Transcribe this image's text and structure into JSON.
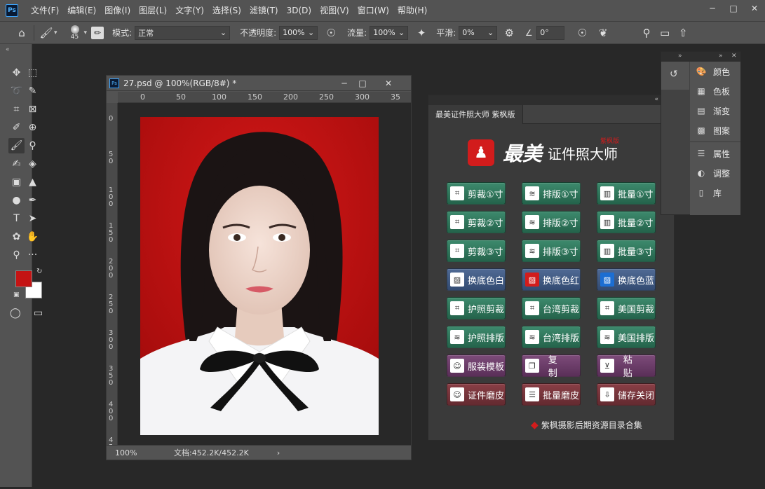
{
  "app": {
    "logo": "Ps",
    "menu": [
      "文件(F)",
      "编辑(E)",
      "图像(I)",
      "图层(L)",
      "文字(Y)",
      "选择(S)",
      "滤镜(T)",
      "3D(D)",
      "视图(V)",
      "窗口(W)",
      "帮助(H)"
    ],
    "window_controls": [
      "minimize-icon",
      "maximize-icon",
      "close-icon"
    ]
  },
  "options": {
    "brush_size": "45",
    "mode_label": "模式:",
    "mode_value": "正常",
    "opacity_label": "不透明度:",
    "opacity_value": "100%",
    "flow_label": "流量:",
    "flow_value": "100%",
    "smooth_label": "平滑:",
    "smooth_value": "0%",
    "angle_value": "0°"
  },
  "toolbar": {
    "tools": [
      "move-icon",
      "marquee-icon",
      "lasso-icon",
      "quick-select-icon",
      "crop-icon",
      "frame-icon",
      "eyedropper-icon",
      "spot-heal-icon",
      "brush-icon",
      "stamp-icon",
      "history-brush-icon",
      "eraser-icon",
      "gradient-icon",
      "blur-icon",
      "dodge-icon",
      "pen-icon",
      "type-icon",
      "path-select-icon",
      "shape-icon",
      "hand-icon",
      "zoom-icon",
      "more-icon"
    ],
    "colors": {
      "foreground": "#c41414",
      "background": "#ffffff"
    }
  },
  "document": {
    "title": "27.psd @ 100%(RGB/8#) *",
    "ruler_h": [
      "0",
      "50",
      "100",
      "150",
      "200",
      "250",
      "300",
      "35"
    ],
    "ruler_v": [
      "0",
      "5 0",
      "1 0 0",
      "1 5 0",
      "2 0 0",
      "2 5 0",
      "3 0 0",
      "3 5 0",
      "4 0 0",
      "4 5"
    ],
    "zoom": "100%",
    "doc_info": "文档:452.2K/452.2K"
  },
  "plugin": {
    "tab": "最美证件照大师 紫枫版",
    "logo_main": "最美",
    "logo_sub": "证件照大师",
    "logo_tag": "紫枫版",
    "buttons": [
      {
        "label": "剪裁①寸",
        "icon": "crop-icon",
        "color": "green"
      },
      {
        "label": "排版①寸",
        "icon": "layers-icon",
        "color": "green"
      },
      {
        "label": "批量①寸",
        "icon": "bars-icon",
        "color": "green"
      },
      {
        "label": "剪裁②寸",
        "icon": "crop-icon",
        "color": "green"
      },
      {
        "label": "排版②寸",
        "icon": "layers-icon",
        "color": "green"
      },
      {
        "label": "批量②寸",
        "icon": "bars-icon",
        "color": "green"
      },
      {
        "label": "剪裁③寸",
        "icon": "crop-icon",
        "color": "green"
      },
      {
        "label": "排版③寸",
        "icon": "layers-icon",
        "color": "green"
      },
      {
        "label": "批量③寸",
        "icon": "bars-icon",
        "color": "green"
      },
      {
        "label": "换底色白",
        "icon": "image-white-icon",
        "color": "blue"
      },
      {
        "label": "换底色红",
        "icon": "image-red-icon",
        "color": "blue"
      },
      {
        "label": "换底色蓝",
        "icon": "image-blue-icon",
        "color": "blue"
      },
      {
        "label": "护照剪裁",
        "icon": "crop-icon",
        "color": "green"
      },
      {
        "label": "台湾剪裁",
        "icon": "crop-icon",
        "color": "green"
      },
      {
        "label": "美国剪裁",
        "icon": "crop-icon",
        "color": "green"
      },
      {
        "label": "护照排版",
        "icon": "layers-icon",
        "color": "green"
      },
      {
        "label": "台湾排版",
        "icon": "layers-icon",
        "color": "green"
      },
      {
        "label": "美国排版",
        "icon": "layers-icon",
        "color": "green"
      },
      {
        "label": "服装模板",
        "icon": "person-icon",
        "color": "purple"
      },
      {
        "label": "复制",
        "icon": "copy-icon",
        "color": "purple"
      },
      {
        "label": "粘贴",
        "icon": "paste-icon",
        "color": "purple"
      },
      {
        "label": "证件磨皮",
        "icon": "person-icon",
        "color": "maroon"
      },
      {
        "label": "批量磨皮",
        "icon": "list-icon",
        "color": "maroon"
      },
      {
        "label": "储存关闭",
        "icon": "download-icon",
        "color": "maroon"
      }
    ],
    "footer": "紫枫摄影后期资源目录合集"
  },
  "right_panel": {
    "items": [
      {
        "label": "颜色",
        "icon": "palette-icon"
      },
      {
        "label": "色板",
        "icon": "swatches-icon"
      },
      {
        "label": "渐变",
        "icon": "gradient-icon"
      },
      {
        "label": "图案",
        "icon": "pattern-icon"
      },
      {
        "label": "属性",
        "icon": "sliders-icon"
      },
      {
        "label": "调整",
        "icon": "adjust-icon"
      },
      {
        "label": "库",
        "icon": "library-icon"
      }
    ]
  }
}
